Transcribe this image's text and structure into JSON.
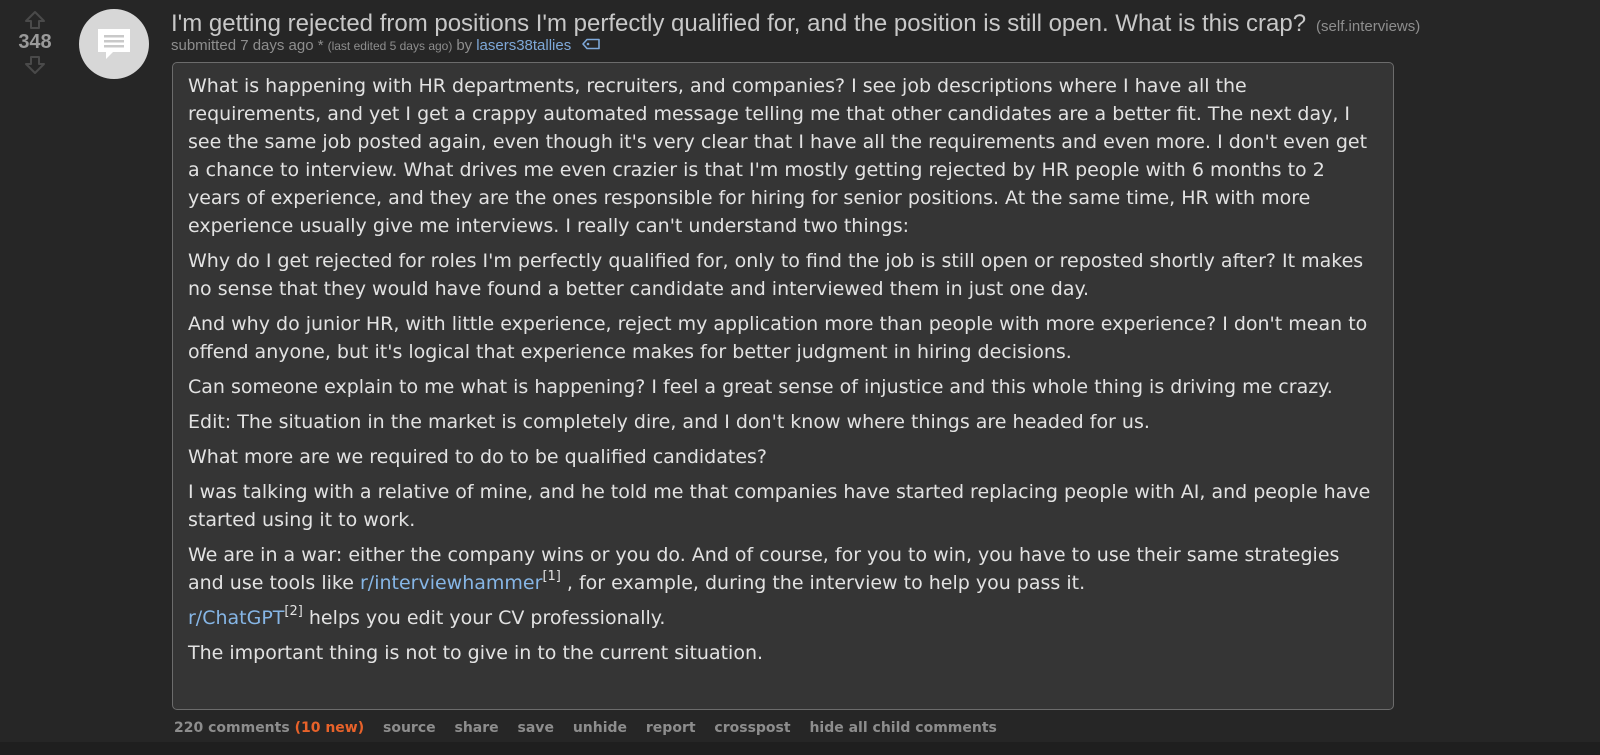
{
  "post": {
    "score": "348",
    "title": "I'm getting rejected from positions I'm perfectly qualified for, and the position is still open. What is this crap?",
    "domain": "(self.interviews)",
    "submitted": "submitted 7 days ago *",
    "edited": "(last edited 5 days ago)",
    "by": "by",
    "author": "lasers38tallies",
    "body": {
      "p1": "What is happening with HR departments, recruiters, and companies? I see job descriptions where I have all the requirements, and yet I get a crappy automated message telling me that other candidates are a better fit. The next day, I see the same job posted again, even though it's very clear that I have all the requirements and even more. I don't even get a chance to interview. What drives me even crazier is that I'm mostly getting rejected by HR people with 6 months to 2 years of experience, and they are the ones responsible for hiring for senior positions. At the same time, HR with more experience usually give me interviews. I really can't understand two things:",
      "p2": "Why do I get rejected for roles I'm perfectly qualified for, only to find the job is still open or reposted shortly after? It makes no sense that they would have found a better candidate and interviewed them in just one day.",
      "p3": "And why do junior HR, with little experience, reject my application more than people with more experience? I don't mean to offend anyone, but it's logical that experience makes for better judgment in hiring decisions.",
      "p4": "Can someone explain to me what is happening? I feel a great sense of injustice and this whole thing is driving me crazy.",
      "p5": "Edit: The situation in the market is completely dire, and I don't know where things are headed for us.",
      "p6": "What more are we required to do to be qualified candidates?",
      "p7": "I was talking with a relative of mine, and he told me that companies have started replacing people with AI, and people have started using it to work.",
      "p8_before": "We are in a war: either the company wins or you do. And of course, for you to win, you have to use their same strategies and use tools like ",
      "p8_link": "r/interviewhammer",
      "p8_sup": "[1]",
      "p8_after": " , for example, during the interview to help you pass it.",
      "p9_link": "r/ChatGPT",
      "p9_sup": "[2]",
      "p9_after": " helps you edit your CV professionally.",
      "p10": "The important thing is not to give in to the current situation."
    }
  },
  "buttons": {
    "comments": "220 comments",
    "new": "(10 new)",
    "source": "source",
    "share": "share",
    "save": "save",
    "unhide": "unhide",
    "report": "report",
    "crosspost": "crosspost",
    "hide_children": "hide all child comments"
  },
  "colors": {
    "background": "#262626",
    "body_bg": "#353535",
    "link": "#86b6e6",
    "new_comments": "#e8622a"
  },
  "icons": {
    "upvote": "upvote-arrow-icon",
    "downvote": "downvote-arrow-icon",
    "thumbnail": "self-post-chat-icon",
    "flair": "tag-icon"
  }
}
